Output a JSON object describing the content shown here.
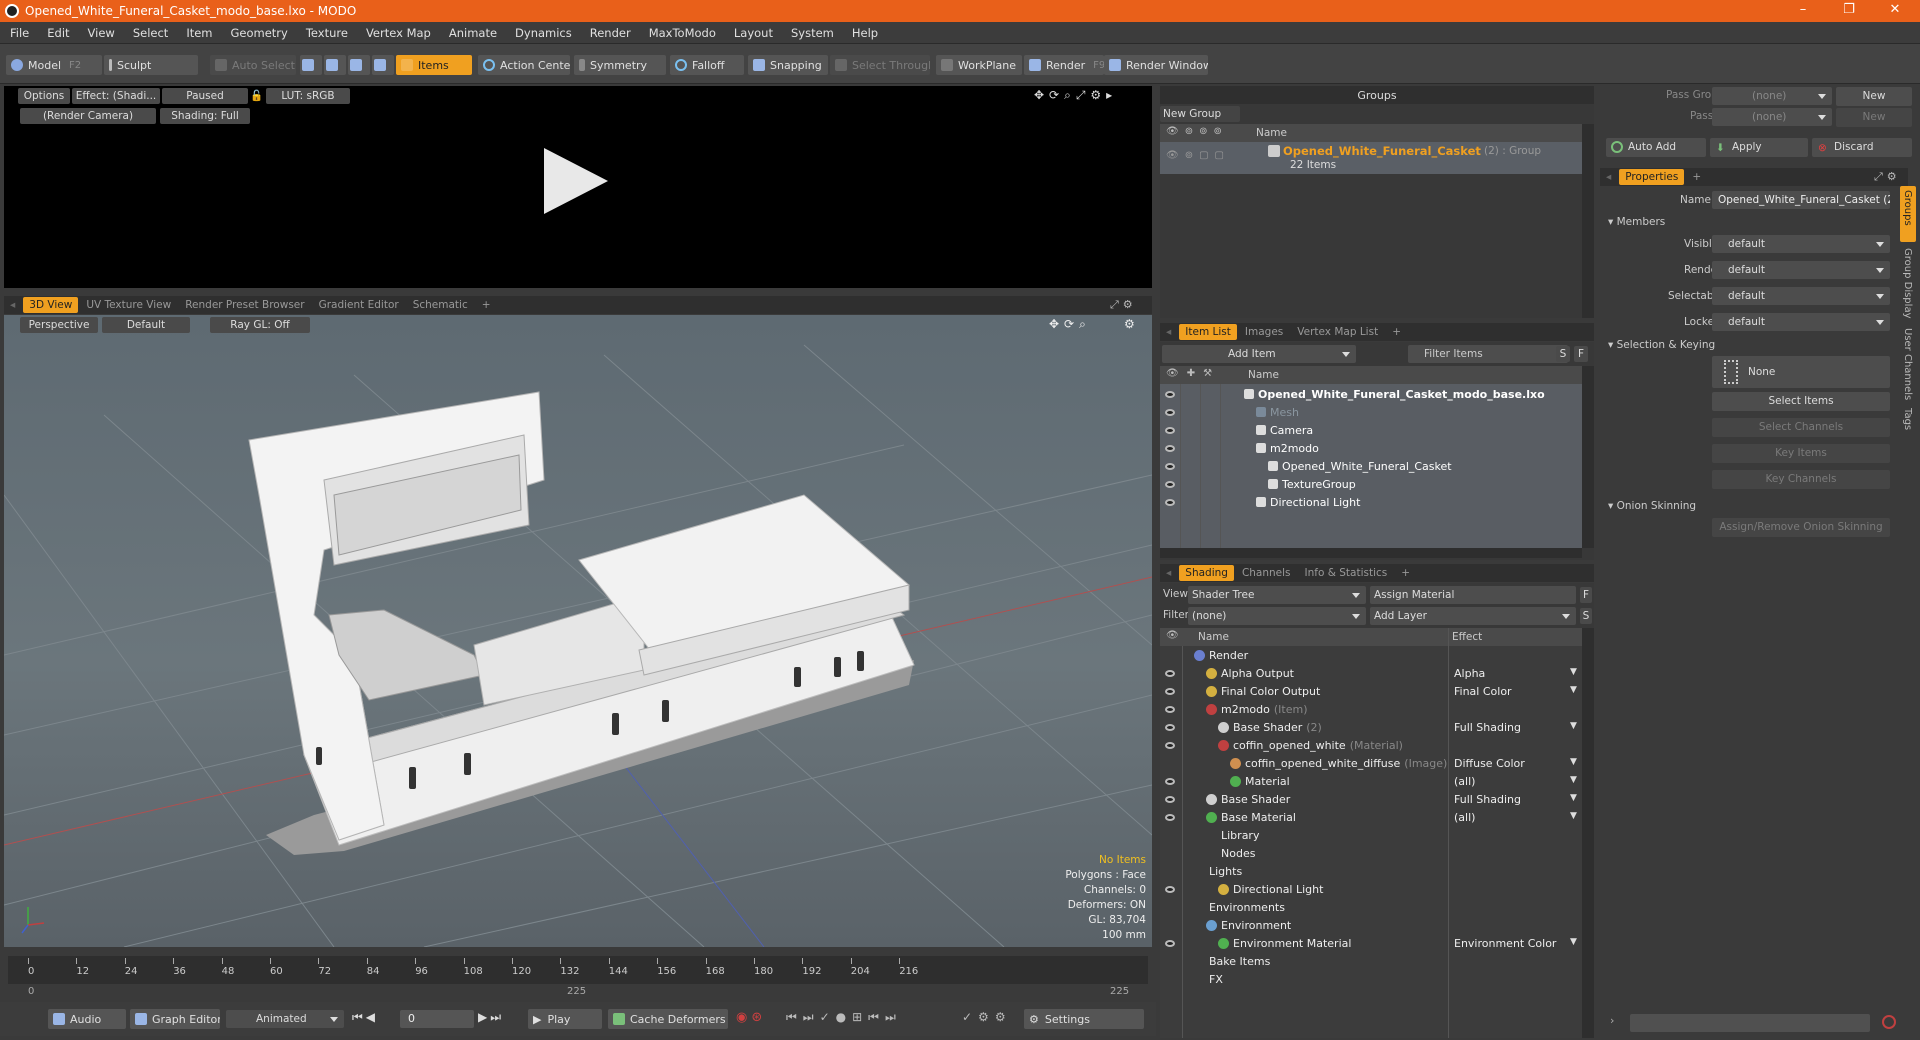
{
  "window": {
    "title": "Opened_White_Funeral_Casket_modo_base.lxo - MODO",
    "minimize": "–",
    "restore": "❐",
    "close": "✕"
  },
  "menu": [
    "File",
    "Edit",
    "View",
    "Select",
    "Item",
    "Geometry",
    "Texture",
    "Vertex Map",
    "Animate",
    "Dynamics",
    "Render",
    "MaxToModo",
    "Layout",
    "System",
    "Help"
  ],
  "toolbar": {
    "model": "Model",
    "model_key": "F2",
    "sculpt": "Sculpt",
    "auto_select": "Auto Select",
    "items": "Items",
    "action_center": "Action Center",
    "symmetry": "Symmetry",
    "falloff": "Falloff",
    "snapping": "Snapping",
    "select_through": "Select Through",
    "workplane": "WorkPlane",
    "render": "Render",
    "render_key": "F9",
    "render_window": "Render Window"
  },
  "preview": {
    "options": "Options",
    "effect": "Effect: (Shadi...",
    "paused": "Paused",
    "lut": "LUT: sRGB",
    "camera": "(Render Camera)",
    "shading": "Shading: Full"
  },
  "viewport_tabs": [
    "3D View",
    "UV Texture View",
    "Render Preset Browser",
    "Gradient Editor",
    "Schematic",
    "+"
  ],
  "viewport": {
    "perspective": "Perspective",
    "default": "Default",
    "raygl": "Ray GL: Off",
    "stats": {
      "no_items": "No Items",
      "polygons": "Polygons : Face",
      "channels": "Channels: 0",
      "deformers": "Deformers: ON",
      "gl": "GL: 83,704",
      "scale": "100 mm"
    }
  },
  "timeline": {
    "ticks": [
      "0",
      "12",
      "24",
      "36",
      "48",
      "60",
      "72",
      "84",
      "96",
      "108",
      "120",
      "132",
      "144",
      "156",
      "168",
      "180",
      "192",
      "204",
      "216"
    ],
    "range_start": "0",
    "range_mid": "225",
    "range_end": "225"
  },
  "bottom": {
    "audio": "Audio",
    "graph_editor": "Graph Editor",
    "animated": "Animated",
    "frame": "0",
    "play": "Play",
    "cache": "Cache Deformers",
    "settings": "Settings"
  },
  "groups": {
    "title": "Groups",
    "new_group": "New Group",
    "col_name": "Name",
    "item_name": "Opened_White_Funeral_Casket",
    "item_suffix": "(2) : Group",
    "item_count": "22 Items"
  },
  "itemlist": {
    "tabs": [
      "Item List",
      "Images",
      "Vertex Map List",
      "+"
    ],
    "add_item": "Add Item",
    "filter": "Filter Items",
    "s": "S",
    "f": "F",
    "col_name": "Name",
    "rows": [
      {
        "label": "Opened_White_Funeral_Casket_modo_base.lxo",
        "bold": true,
        "dim": false,
        "indent": 0
      },
      {
        "label": "Mesh",
        "bold": false,
        "dim": true,
        "indent": 1
      },
      {
        "label": "Camera",
        "bold": false,
        "dim": false,
        "indent": 1
      },
      {
        "label": "m2modo",
        "bold": false,
        "dim": false,
        "indent": 1
      },
      {
        "label": "Opened_White_Funeral_Casket",
        "bold": false,
        "dim": false,
        "indent": 2
      },
      {
        "label": "TextureGroup",
        "bold": false,
        "dim": false,
        "indent": 2
      },
      {
        "label": "Directional Light",
        "bold": false,
        "dim": false,
        "indent": 1
      }
    ]
  },
  "shading": {
    "tabs": [
      "Shading",
      "Channels",
      "Info & Statistics",
      "+"
    ],
    "view_label": "View",
    "view_value": "Shader Tree",
    "assign_material": "Assign Material",
    "f": "F",
    "filter_label": "Filter",
    "filter_value": "(none)",
    "add_layer": "Add Layer",
    "s": "S",
    "col_name": "Name",
    "col_effect": "Effect",
    "rows": [
      {
        "label": "Render",
        "note": "",
        "effect": "",
        "indent": 0,
        "eye": false,
        "color": "#6a7fd0"
      },
      {
        "label": "Alpha Output",
        "note": "",
        "effect": "Alpha",
        "indent": 1,
        "eye": true,
        "color": "#d4b040"
      },
      {
        "label": "Final Color Output",
        "note": "",
        "effect": "Final Color",
        "indent": 1,
        "eye": true,
        "color": "#d4b040"
      },
      {
        "label": "m2modo",
        "note": "(Item)",
        "effect": "",
        "indent": 1,
        "eye": true,
        "color": "#c04040"
      },
      {
        "label": "Base Shader",
        "note": "(2)",
        "effect": "Full Shading",
        "indent": 2,
        "eye": true,
        "color": "#cfcfcf"
      },
      {
        "label": "coffin_opened_white",
        "note": "(Material)",
        "effect": "",
        "indent": 2,
        "eye": true,
        "color": "#c04040"
      },
      {
        "label": "coffin_opened_white_diffuse",
        "note": "(Image)",
        "effect": "Diffuse Color",
        "indent": 3,
        "eye": false,
        "color": "#d09050"
      },
      {
        "label": "Material",
        "note": "",
        "effect": "(all)",
        "indent": 3,
        "eye": true,
        "color": "#50b050"
      },
      {
        "label": "Base Shader",
        "note": "",
        "effect": "Full Shading",
        "indent": 1,
        "eye": true,
        "color": "#cfcfcf"
      },
      {
        "label": "Base Material",
        "note": "",
        "effect": "(all)",
        "indent": 1,
        "eye": true,
        "color": "#50b050"
      },
      {
        "label": "Library",
        "note": "",
        "effect": "",
        "indent": 1,
        "eye": false,
        "color": ""
      },
      {
        "label": "Nodes",
        "note": "",
        "effect": "",
        "indent": 1,
        "eye": false,
        "color": ""
      },
      {
        "label": "Lights",
        "note": "",
        "effect": "",
        "indent": 0,
        "eye": false,
        "color": ""
      },
      {
        "label": "Directional Light",
        "note": "",
        "effect": "",
        "indent": 2,
        "eye": true,
        "color": "#d4b040"
      },
      {
        "label": "Environments",
        "note": "",
        "effect": "",
        "indent": 0,
        "eye": false,
        "color": ""
      },
      {
        "label": "Environment",
        "note": "",
        "effect": "",
        "indent": 1,
        "eye": false,
        "color": "#6a9fd0"
      },
      {
        "label": "Environment Material",
        "note": "",
        "effect": "Environment Color",
        "indent": 2,
        "eye": true,
        "color": "#50b050"
      },
      {
        "label": "Bake Items",
        "note": "",
        "effect": "",
        "indent": 0,
        "eye": false,
        "color": ""
      },
      {
        "label": "FX",
        "note": "",
        "effect": "",
        "indent": 0,
        "eye": false,
        "color": ""
      }
    ]
  },
  "right": {
    "pass_groups": "Pass Groups",
    "pass_groups_val": "(none)",
    "new": "New",
    "passes": "Passes",
    "passes_val": "(none)",
    "new2": "New",
    "auto_add": "Auto Add",
    "apply": "Apply",
    "discard": "Discard",
    "properties_tab": "Properties",
    "plus": "+",
    "name_label": "Name",
    "name_value": "Opened_White_Funeral_Casket (2",
    "members": "Members",
    "visible": "Visible",
    "render": "Render",
    "selectable": "Selectable",
    "locked": "Locked",
    "default_val": "default",
    "sel_keying": "Selection & Keying",
    "none": "None",
    "select_items": "Select Items",
    "select_channels": "Select Channels",
    "key_items": "Key Items",
    "key_channels": "Key Channels",
    "onion": "Onion Skinning",
    "assign_onion": "Assign/Remove Onion Skinning",
    "side_tabs": [
      "Groups",
      "Group Display",
      "User Channels",
      "Tags"
    ]
  }
}
